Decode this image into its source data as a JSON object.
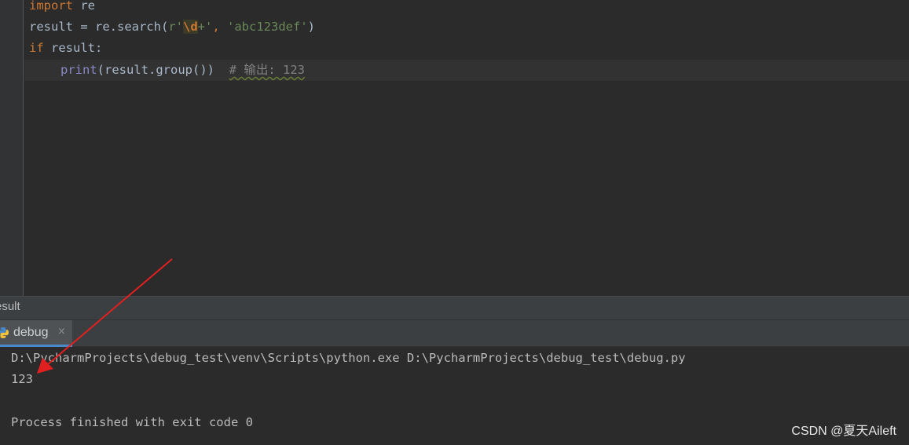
{
  "editor": {
    "lines": [
      {
        "kw": "import",
        "rest": " re"
      },
      {
        "pre": "result = re.search(",
        "str_open": "r'",
        "esc": "\\d",
        "plus": "+",
        "str_close": "'",
        "sep": ", ",
        "str2": "'abc123def'",
        "close": ")"
      },
      {
        "kw": "if",
        "rest": " result:"
      },
      {
        "fn": "print",
        "rest": "(result.group())",
        "comment": "# 输出: 123"
      }
    ]
  },
  "run_panel": {
    "title": "esult",
    "tab_label": "debug",
    "tab_close": "×",
    "tab_icon": "python-icon",
    "console": [
      "D:\\PycharmProjects\\debug_test\\venv\\Scripts\\python.exe D:\\PycharmProjects\\debug_test\\debug.py",
      "123",
      "",
      "Process finished with exit code 0"
    ]
  },
  "annotation": {
    "color": "#e02020"
  },
  "watermark": "CSDN @夏天Aileft"
}
